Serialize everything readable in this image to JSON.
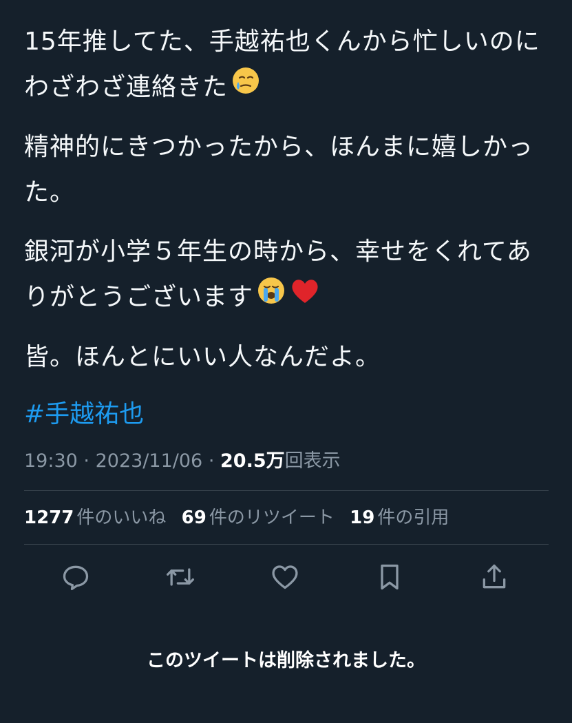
{
  "tweet": {
    "paragraphs": [
      "15年推してた、手越祐也くんから忙しいのにわざわざ連絡きた",
      "精神的にきつかったから、ほんまに嬉しかった。",
      "銀河が小学５年生の時から、幸せをくれてありがとうございます",
      "皆。ほんとにいい人なんだよ。"
    ],
    "emojis": {
      "p1": "holding-back-tears-emoji",
      "p3a": "loudly-crying-emoji",
      "p3b": "red-heart-emoji"
    },
    "hashtag": "#手越祐也"
  },
  "meta": {
    "time": "19:30",
    "separator": "·",
    "date": "2023/11/06",
    "views_count": "20.5万",
    "views_label": "回表示"
  },
  "stats": {
    "likes_count": "1277",
    "likes_label": "件のいいね",
    "retweets_count": "69",
    "retweets_label": "件のリツイート",
    "quotes_count": "19",
    "quotes_label": "件の引用"
  },
  "actions": [
    "reply-icon",
    "retweet-icon",
    "like-icon",
    "bookmark-icon",
    "share-icon"
  ],
  "colors": {
    "background": "#15202b",
    "text": "#f5f8fa",
    "link": "#1d9bf0",
    "muted": "#8b98a5",
    "divider": "#38444d"
  },
  "notice": "このツイートは削除されました。"
}
